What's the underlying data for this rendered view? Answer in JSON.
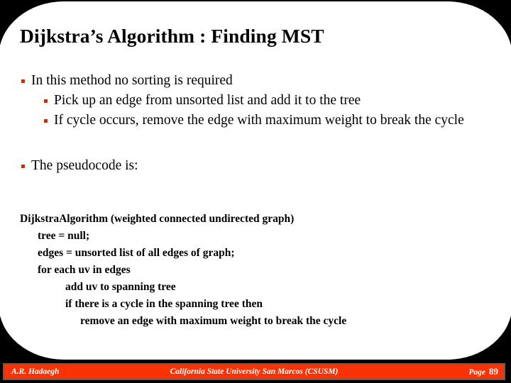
{
  "slide": {
    "title": "Dijkstra’s Algorithm : Finding MST",
    "bullet_color": "#b23a16",
    "background_color": "#000000",
    "panel_color": "#ffffff",
    "text_color": "#000000"
  },
  "bullets": [
    {
      "level": 1,
      "text": "In this method no sorting is required"
    },
    {
      "level": 2,
      "text": "Pick up an edge from unsorted list and add it to the tree"
    },
    {
      "level": 2,
      "text": "If cycle occurs, remove the edge with maximum weight to break the cycle"
    },
    {
      "level": 1,
      "text": "The pseudocode is:"
    }
  ],
  "pseudocode": {
    "lines": [
      {
        "indent": 0,
        "text": "DijkstraAlgorithm (weighted connected undirected graph)"
      },
      {
        "indent": 1,
        "text": "tree = null;"
      },
      {
        "indent": 1,
        "text": "edges = unsorted list of all edges of graph;"
      },
      {
        "indent": 1,
        "text": "for each uv in edges"
      },
      {
        "indent": 2,
        "text": "add uv to spanning tree"
      },
      {
        "indent": 2,
        "text": "if there is a cycle in the spanning tree then"
      },
      {
        "indent": 3,
        "text": "remove an edge with maximum weight to break the cycle"
      }
    ]
  },
  "footer": {
    "author": "A.R. Hadaegh",
    "institution": "California State University San Marcos (CSUSM)",
    "page_label": "Page",
    "page_number": "89",
    "bar_color": "#f93305",
    "border_color": "#6b5b50",
    "text_color": "#ffffff"
  }
}
